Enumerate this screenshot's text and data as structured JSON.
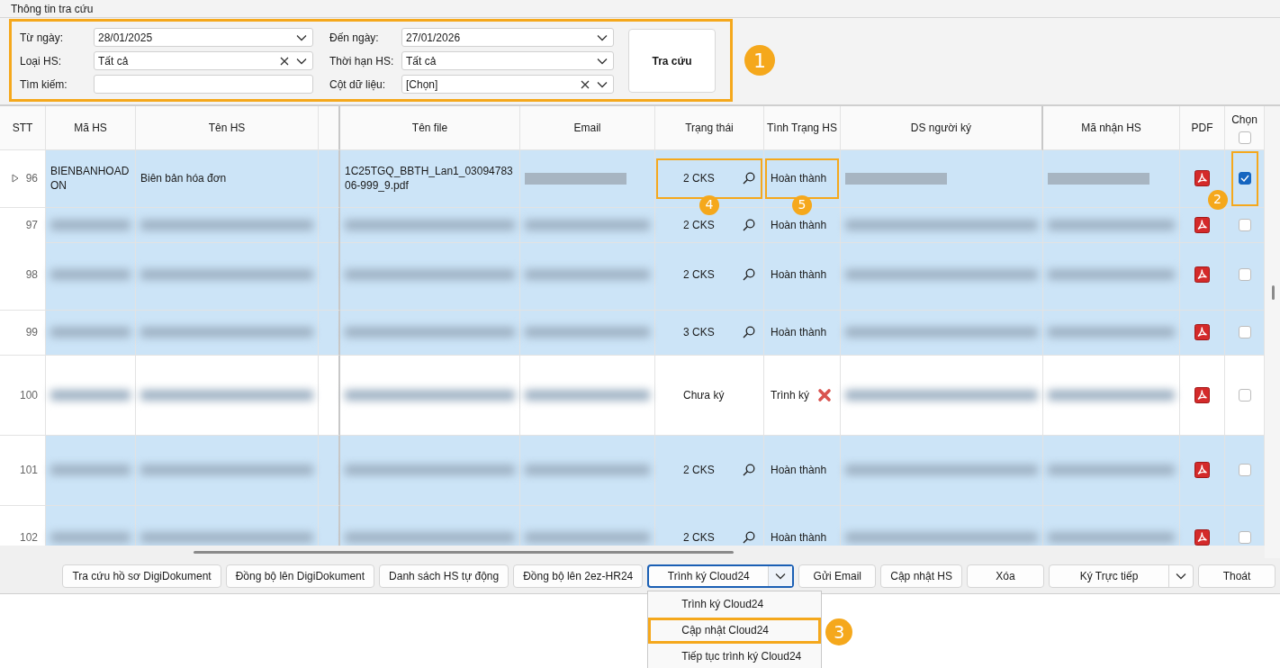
{
  "section_title": "Thông tin tra cứu",
  "filter": {
    "highlighted": true,
    "badge": "1",
    "search_button": "Tra cứu",
    "fields": [
      {
        "label": "Từ ngày:",
        "value": "28/01/2025",
        "kind": "dropdown",
        "clearable": false
      },
      {
        "label": "Đến ngày:",
        "value": "27/01/2026",
        "kind": "dropdown",
        "clearable": false
      },
      {
        "label": "Loại HS:",
        "value": "Tất cả",
        "kind": "dropdown",
        "clearable": true
      },
      {
        "label": "Thời hạn HS:",
        "value": "Tất cả",
        "kind": "dropdown",
        "clearable": false
      },
      {
        "label": "Tìm kiếm:",
        "kind": "text"
      },
      {
        "label": "Cột dữ liệu:",
        "value": "[Chọn]",
        "kind": "dropdown",
        "clearable": true
      }
    ]
  },
  "table": {
    "select_all_checked": false,
    "columns": [
      {
        "kind": "number",
        "label": "STT"
      },
      {
        "kind": "text",
        "label": "Mã HS"
      },
      {
        "kind": "text",
        "label": "Tên HS"
      },
      {
        "kind": "spacer"
      },
      {
        "kind": "text",
        "label": "Tên file"
      },
      {
        "kind": "text",
        "label": "Email"
      },
      {
        "kind": "status",
        "label": "Trạng thái"
      },
      {
        "kind": "condition",
        "label": "Tình Trạng HS"
      },
      {
        "kind": "text",
        "label": "DS người ký"
      },
      {
        "kind": "text",
        "label": "Mã nhận HS"
      },
      {
        "kind": "pdf",
        "label": "PDF"
      },
      {
        "kind": "select",
        "label": "Chọn"
      }
    ],
    "rows": [
      {
        "current": true,
        "selected": true,
        "cells": [
          {
            "text": "96"
          },
          {
            "text": "BIENBANHOADON"
          },
          {
            "text": "Biên bản hóa đơn"
          },
          {},
          {
            "text": "1C25TGQ_BBTH_Lan1_0309478306-999_9.pdf"
          },
          {
            "redacted": true
          },
          {
            "text": "2 CKS",
            "kind": "lookup",
            "highlighted": true,
            "badge": "4"
          },
          {
            "text": "Hoàn thành",
            "kind": "done",
            "highlighted": true,
            "badge": "5"
          },
          {
            "redacted": true
          },
          {
            "redacted": true
          },
          {},
          {
            "checked": true,
            "highlighted": true,
            "badge": "2"
          }
        ]
      },
      {
        "current": false,
        "selected": true,
        "cells": [
          {
            "text": "97"
          },
          {
            "redacted": true
          },
          {
            "redacted": true
          },
          {},
          {
            "redacted": true
          },
          {
            "redacted": true
          },
          {
            "text": "2 CKS",
            "kind": "lookup"
          },
          {
            "text": "Hoàn thành",
            "kind": "done"
          },
          {
            "redacted": true
          },
          {
            "redacted": true
          },
          {},
          {
            "checked": false
          }
        ]
      },
      {
        "current": false,
        "selected": true,
        "cells": [
          {
            "text": "98"
          },
          {
            "redacted": true
          },
          {
            "redacted": true
          },
          {},
          {
            "redacted": true
          },
          {
            "redacted": true
          },
          {
            "text": "2 CKS",
            "kind": "lookup"
          },
          {
            "text": "Hoàn thành",
            "kind": "done"
          },
          {
            "redacted": true
          },
          {
            "redacted": true
          },
          {},
          {
            "checked": false
          }
        ]
      },
      {
        "current": false,
        "selected": true,
        "cells": [
          {
            "text": "99"
          },
          {
            "redacted": true
          },
          {
            "redacted": true
          },
          {},
          {
            "redacted": true
          },
          {
            "redacted": true
          },
          {
            "text": "3 CKS",
            "kind": "lookup"
          },
          {
            "text": "Hoàn thành",
            "kind": "done"
          },
          {
            "redacted": true
          },
          {
            "redacted": true
          },
          {},
          {
            "checked": false
          }
        ]
      },
      {
        "current": false,
        "selected": false,
        "cells": [
          {
            "text": "100"
          },
          {
            "redacted": true
          },
          {
            "redacted": true
          },
          {},
          {
            "redacted": true
          },
          {
            "redacted": true
          },
          {
            "text": "Chưa ký",
            "kind": "plain"
          },
          {
            "text": "Trình ký",
            "kind": "rejected"
          },
          {
            "redacted": true
          },
          {
            "redacted": true
          },
          {},
          {
            "checked": false
          }
        ]
      },
      {
        "current": false,
        "selected": true,
        "cells": [
          {
            "text": "101"
          },
          {
            "redacted": true
          },
          {
            "redacted": true
          },
          {},
          {
            "redacted": true
          },
          {
            "redacted": true
          },
          {
            "text": "2 CKS",
            "kind": "lookup"
          },
          {
            "text": "Hoàn thành",
            "kind": "done"
          },
          {
            "redacted": true
          },
          {
            "redacted": true
          },
          {},
          {
            "checked": false
          }
        ]
      },
      {
        "current": false,
        "selected": true,
        "cells": [
          {
            "text": "102"
          },
          {
            "redacted": true
          },
          {
            "redacted": true
          },
          {},
          {
            "redacted": true
          },
          {
            "redacted": true
          },
          {
            "text": "2 CKS",
            "kind": "lookup"
          },
          {
            "text": "Hoàn thành",
            "kind": "done"
          },
          {
            "redacted": true
          },
          {
            "redacted": true
          },
          {},
          {
            "checked": false
          }
        ]
      }
    ]
  },
  "buttons": [
    {
      "label": "Tra cứu hồ sơ DigiDokument",
      "kind": "button"
    },
    {
      "label": "Đồng bộ lên DigiDokument",
      "kind": "button"
    },
    {
      "label": "Danh sách HS tự động",
      "kind": "button"
    },
    {
      "label": "Đồng bộ lên 2ez-HR24",
      "kind": "button"
    },
    {
      "label": "Trình ký Cloud24",
      "kind": "split",
      "focused": true,
      "expanded": true,
      "menu": [
        {
          "label": "Trình ký Cloud24",
          "highlighted": false
        },
        {
          "label": "Cập nhật Cloud24",
          "highlighted": true,
          "badge": "3"
        },
        {
          "label": "Tiếp tục trình ký Cloud24",
          "highlighted": false
        }
      ]
    },
    {
      "label": "Gửi Email",
      "kind": "button"
    },
    {
      "label": "Cập nhật HS",
      "kind": "button"
    },
    {
      "label": "Xóa",
      "kind": "button"
    },
    {
      "label": "Ký Trực tiếp",
      "kind": "split",
      "focused": false,
      "expanded": false
    },
    {
      "label": "Thoát",
      "kind": "button"
    }
  ]
}
